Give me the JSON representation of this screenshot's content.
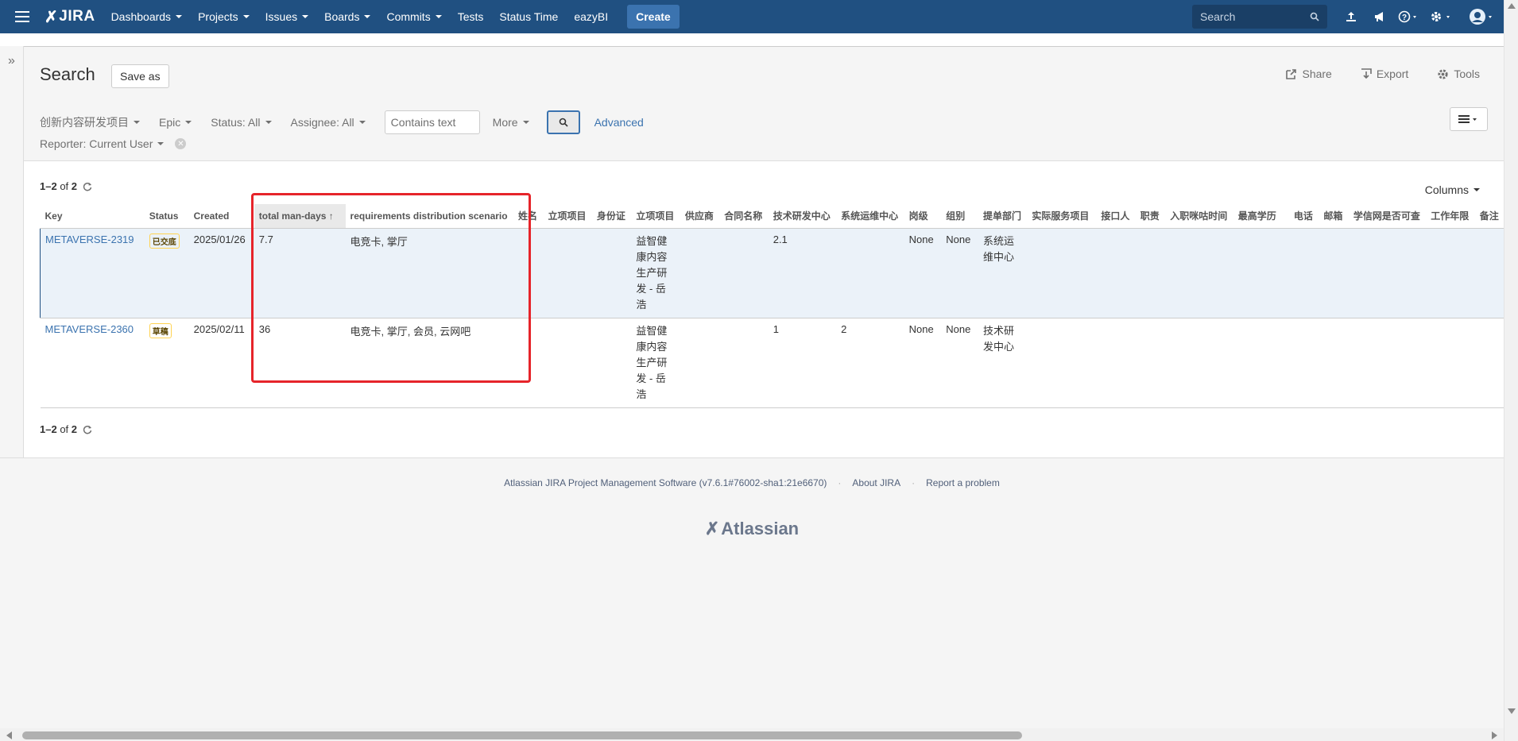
{
  "topnav": {
    "logo": "JIRA",
    "items": [
      "Dashboards",
      "Projects",
      "Issues",
      "Boards",
      "Commits",
      "Tests",
      "Status Time",
      "eazyBI"
    ],
    "items_with_caret": [
      true,
      true,
      true,
      true,
      true,
      false,
      false,
      false
    ],
    "create": "Create",
    "search_placeholder": "Search"
  },
  "header": {
    "title": "Search",
    "save_as": "Save as",
    "share": "Share",
    "export": "Export",
    "tools": "Tools"
  },
  "filters": {
    "project": "创新内容研发项目",
    "epic": "Epic",
    "status": "Status: All",
    "assignee": "Assignee: All",
    "text_placeholder": "Contains text",
    "more": "More",
    "advanced": "Advanced",
    "reporter": "Reporter: Current User"
  },
  "results": {
    "count_range": "1–2",
    "count_of": "of",
    "count_total": "2",
    "columns_button": "Columns"
  },
  "table": {
    "columns": [
      "Key",
      "Status",
      "Created",
      "total man-days",
      "requirements distribution scenario",
      "姓名",
      "立项项目",
      "身份证",
      "立项项目",
      "供应商",
      "合同名称",
      "技术研发中心",
      "系统运维中心",
      "岗级",
      "组别",
      "提单部门",
      "实际服务项目",
      "接口人",
      "职责",
      "入职咪咕时间",
      "最高学历",
      "电话",
      "邮箱",
      "学信网是否可查",
      "工作年限",
      "备注"
    ],
    "rows": [
      {
        "key": "METAVERSE-2319",
        "status": "已交底",
        "created": "2025/01/26",
        "man_days": "7.7",
        "scenario": "电竞卡, 掌厅",
        "project": "益智健康内容生产研发 - 岳浩",
        "tech_center": "2.1",
        "ops_center": "",
        "level": "None",
        "group": "None",
        "dept": "系统运维中心"
      },
      {
        "key": "METAVERSE-2360",
        "status": "草稿",
        "created": "2025/02/11",
        "man_days": "36",
        "scenario": "电竞卡, 掌厅, 会员, 云网吧",
        "project": "益智健康内容生产研发 - 岳浩",
        "tech_center": "1",
        "ops_center": "2",
        "level": "None",
        "group": "None",
        "dept": "技术研发中心"
      }
    ]
  },
  "footer": {
    "software": "Atlassian JIRA Project Management Software (v7.6.1#76002-sha1:21e6670)",
    "about": "About JIRA",
    "report": "Report a problem",
    "brand": "Atlassian"
  },
  "colors": {
    "nav_bg": "#205081",
    "link": "#3b73af",
    "highlight": "#e6242a"
  }
}
